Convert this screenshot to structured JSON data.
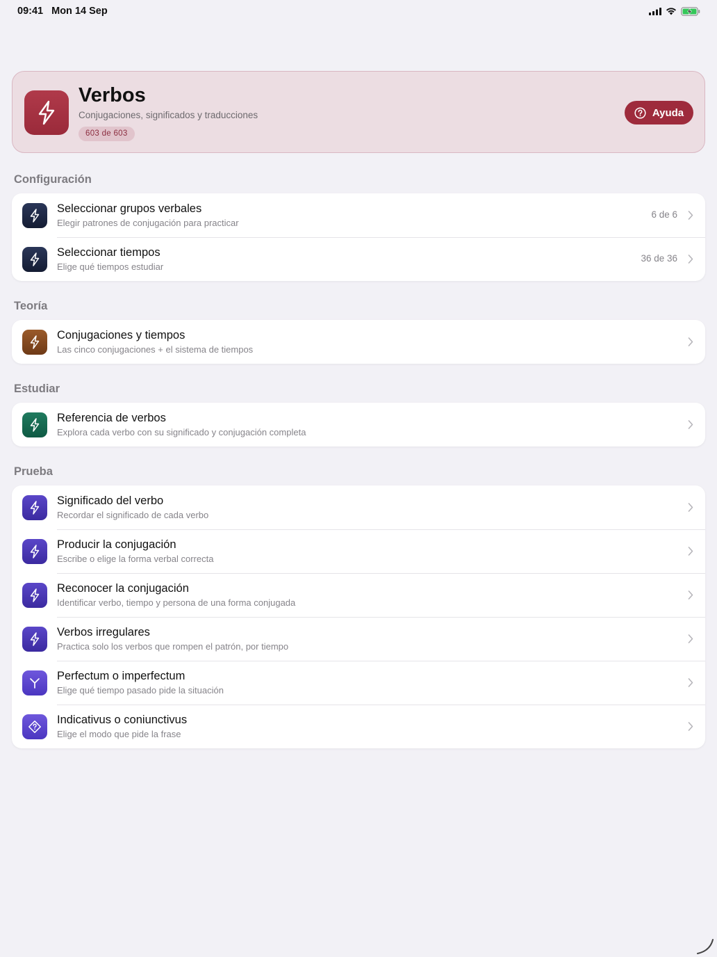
{
  "status": {
    "time": "09:41",
    "date": "Mon 14 Sep"
  },
  "hero": {
    "title": "Verbos",
    "subtitle": "Conjugaciones, significados y traducciones",
    "badge": "603 de 603",
    "help_label": "Ayuda",
    "icon": "bolt-icon",
    "accent": "#9e2b3c"
  },
  "sections": {
    "config": {
      "title": "Configuración",
      "items": [
        {
          "title": "Seleccionar grupos verbales",
          "subtitle": "Elegir patrones de conjugación para practicar",
          "value": "6 de 6",
          "icon": "bolt-icon"
        },
        {
          "title": "Seleccionar tiempos",
          "subtitle": "Elige qué tiempos estudiar",
          "value": "36 de 36",
          "icon": "bolt-icon"
        }
      ]
    },
    "theory": {
      "title": "Teoría",
      "items": [
        {
          "title": "Conjugaciones y tiempos",
          "subtitle": "Las cinco conjugaciones + el sistema de tiempos",
          "icon": "bolt-icon"
        }
      ]
    },
    "study": {
      "title": "Estudiar",
      "items": [
        {
          "title": "Referencia de verbos",
          "subtitle": "Explora cada verbo con su significado y conjugación completa",
          "icon": "bolt-icon"
        }
      ]
    },
    "test": {
      "title": "Prueba",
      "items": [
        {
          "title": "Significado del verbo",
          "subtitle": "Recordar el significado de cada verbo",
          "icon": "bolt-icon"
        },
        {
          "title": "Producir la conjugación",
          "subtitle": "Escribe o elige la forma verbal correcta",
          "icon": "bolt-icon"
        },
        {
          "title": "Reconocer la conjugación",
          "subtitle": "Identificar verbo, tiempo y persona de una forma conjugada",
          "icon": "bolt-icon"
        },
        {
          "title": "Verbos irregulares",
          "subtitle": "Practica solo los verbos que rompen el patrón, por tiempo",
          "icon": "bolt-icon"
        },
        {
          "title": "Perfectum o imperfectum",
          "subtitle": "Elige qué tiempo pasado pide la situación",
          "icon": "branch-icon"
        },
        {
          "title": "Indicativus o coniunctivus",
          "subtitle": "Elige el modo que pide la frase",
          "icon": "diamond-question-icon"
        }
      ]
    }
  }
}
